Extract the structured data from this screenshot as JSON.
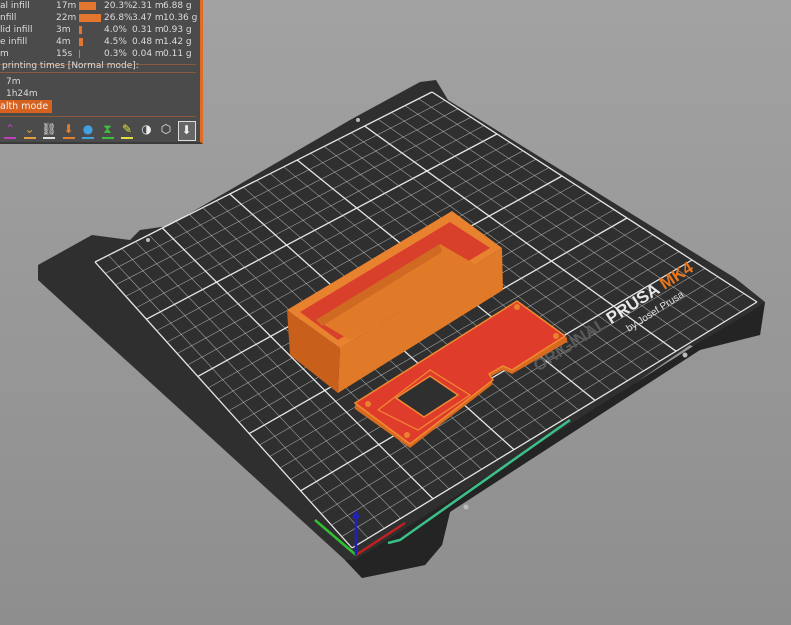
{
  "stats": {
    "rows": [
      {
        "label": "al infill",
        "time": "17m",
        "fraction": 0.203,
        "percent": "20.3%",
        "length": "2.31 m",
        "weight": "6.88 g"
      },
      {
        "label": "nfill",
        "time": "22m",
        "fraction": 0.268,
        "percent": "26.8%",
        "length": "3.47 m",
        "weight": "10.36 g"
      },
      {
        "label": "lid infill",
        "time": "3m",
        "fraction": 0.04,
        "percent": "4.0%",
        "length": "0.31 m",
        "weight": "0.93 g"
      },
      {
        "label": "e infill",
        "time": "4m",
        "fraction": 0.045,
        "percent": "4.5%",
        "length": "0.48 m",
        "weight": "1.42 g"
      },
      {
        "label": "m",
        "time": "15s",
        "fraction": 0.003,
        "percent": "0.3%",
        "length": "0.04 m",
        "weight": "0.11 g"
      }
    ],
    "times_heading": "printing times [Normal mode]:",
    "time_1": "7m",
    "time_2": "1h24m",
    "mode_button": "alth mode"
  },
  "toolbar_icons": [
    {
      "name": "layers-up-icon",
      "glyph": "⌃",
      "color": "#c040c0"
    },
    {
      "name": "layers-down-icon",
      "glyph": "⌄",
      "color": "#e0a040"
    },
    {
      "name": "seam-icon",
      "glyph": "⛓",
      "color": "#e0e0e0"
    },
    {
      "name": "retractions-icon",
      "glyph": "⬇",
      "color": "#e08030"
    },
    {
      "name": "color-change-icon",
      "glyph": "●",
      "color": "#40a0e0"
    },
    {
      "name": "pause-icon",
      "glyph": "⧗",
      "color": "#40c040"
    },
    {
      "name": "custom-gcode-icon",
      "glyph": "✎",
      "color": "#e0e040"
    },
    {
      "name": "center-of-gravity-icon",
      "glyph": "◑",
      "color": ""
    },
    {
      "name": "shells-icon",
      "glyph": "⬡",
      "color": ""
    },
    {
      "name": "tool-marker-icon",
      "glyph": "⬇",
      "color": ""
    }
  ],
  "bed_logo": {
    "original": "ORIGINAL",
    "prusa": "PRUSA",
    "model": "MK4",
    "byline": "by Josef Prusa"
  },
  "colors": {
    "accent": "#e06b24",
    "infill": "#e03c2c",
    "perimeter": "#e8822f",
    "bed": "#2e2e2e"
  }
}
